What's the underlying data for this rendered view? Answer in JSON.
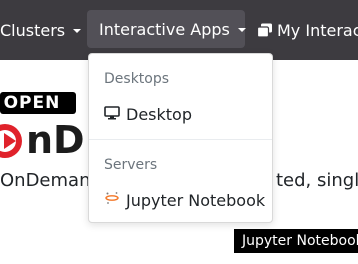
{
  "navbar": {
    "clusters_label": "Clusters",
    "interactive_label": "Interactive Apps",
    "my_interactive_label": "My Interact",
    "icons": {
      "caret": "caret-down-icon",
      "sessions": "clone-icon"
    }
  },
  "dropdown": {
    "group_desktops": "Desktops",
    "desktop_label": "Desktop",
    "group_servers": "Servers",
    "jupyter_label": "Jupyter Notebook",
    "icons": {
      "desktop": "monitor-icon",
      "jupyter": "jupyter-icon"
    }
  },
  "page": {
    "logo_top": "OPEN",
    "logo_main": "nD",
    "tagline_left": "OnDemand",
    "tagline_right": "ted, single"
  },
  "tooltip": {
    "text": "Jupyter Notebook"
  },
  "colors": {
    "navbar_bg": "#3d3b40",
    "active_nav_bg": "#525057",
    "logo_red": "#e0222b",
    "jupyter_orange": "#f37626"
  }
}
